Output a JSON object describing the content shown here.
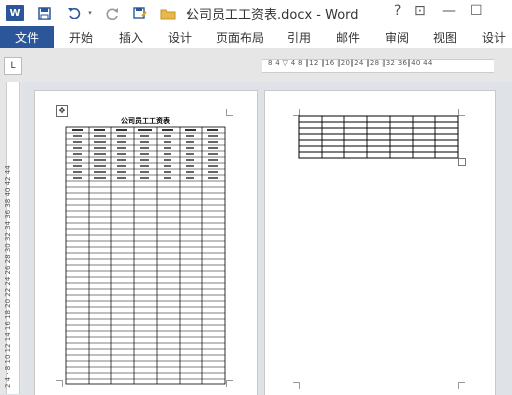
{
  "titlebar": {
    "app_icon": "W",
    "title": "公司员工工资表.docx - Word",
    "help": "?",
    "restore": "⊡",
    "minimize": "—",
    "close": "☐"
  },
  "ribbon": {
    "file": "文件",
    "tabs": [
      "开始",
      "插入",
      "设计",
      "页面布局",
      "引用",
      "邮件",
      "审阅",
      "视图",
      "设计"
    ]
  },
  "ruler": {
    "corner": "L",
    "horizontal": "8  4  ▽  4  8  ‖12  ‖16  ‖20‖24  ‖28  ‖32  36‖40  44",
    "vertical": "2  4  ·  8  10  12  14  16  18  20  22  24  26  28  30  32  34  36  38  40  42  44"
  },
  "document": {
    "heading": "公司员工工资表"
  }
}
